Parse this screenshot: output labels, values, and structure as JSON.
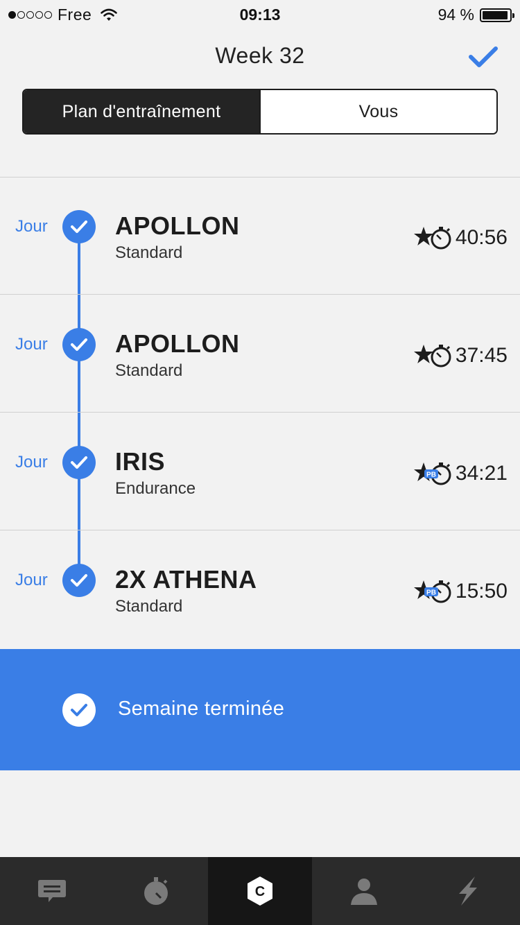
{
  "status_bar": {
    "carrier": "Free",
    "time": "09:13",
    "battery": "94 %",
    "battery_level": 0.94
  },
  "header": {
    "title": "Week 32"
  },
  "segmented": {
    "tabs": [
      {
        "label": "Plan d'entraînement",
        "active": true
      },
      {
        "label": "Vous",
        "active": false
      }
    ]
  },
  "workouts": [
    {
      "day_label": "Jour",
      "name": "APOLLON",
      "type": "Standard",
      "time": "40:56",
      "record_badge": "star-stopwatch"
    },
    {
      "day_label": "Jour",
      "name": "APOLLON",
      "type": "Standard",
      "time": "37:45",
      "record_badge": "star-stopwatch"
    },
    {
      "day_label": "Jour",
      "name": "IRIS",
      "type": "Endurance",
      "time": "34:21",
      "record_badge": "pb-stopwatch"
    },
    {
      "day_label": "Jour",
      "name": "2X ATHENA",
      "type": "Standard",
      "time": "15:50",
      "record_badge": "pb-stopwatch"
    }
  ],
  "week_banner": {
    "label": "Semaine terminée"
  },
  "tab_bar": {
    "items": [
      {
        "icon": "chat-icon"
      },
      {
        "icon": "stopwatch-icon"
      },
      {
        "icon": "freeletics-logo-icon",
        "active": true
      },
      {
        "icon": "profile-icon"
      },
      {
        "icon": "lightning-icon"
      }
    ]
  },
  "colors": {
    "accent": "#3a7ee6",
    "dark": "#242424",
    "background": "#f2f2f2",
    "tab_bar": "#2b2b2b"
  }
}
